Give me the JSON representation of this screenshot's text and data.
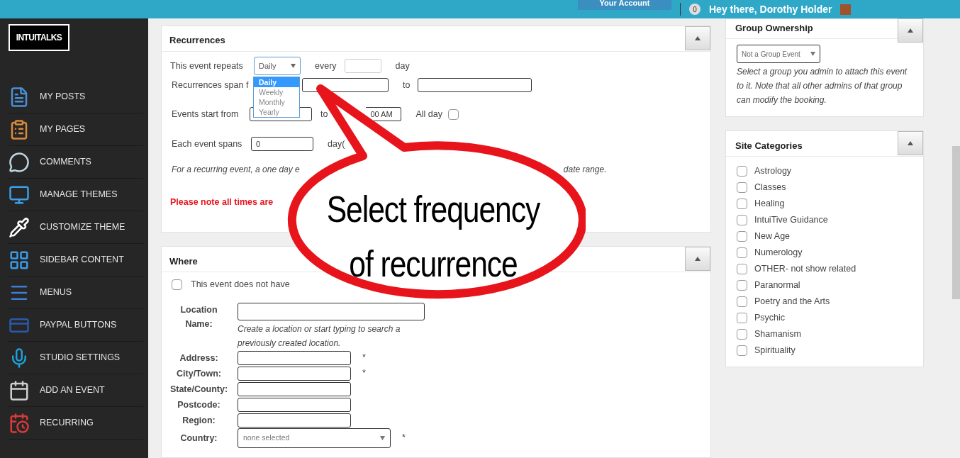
{
  "topbar": {
    "account_button": "Your Account",
    "notification_count": "0",
    "greeting": "Hey there, Dorothy Holder"
  },
  "logo": "INTUITALKS",
  "sidebar": {
    "items": [
      {
        "label": "MY POSTS"
      },
      {
        "label": "MY PAGES"
      },
      {
        "label": "COMMENTS"
      },
      {
        "label": "MANAGE THEMES"
      },
      {
        "label": "CUSTOMIZE THEME"
      },
      {
        "label": "SIDEBAR CONTENT"
      },
      {
        "label": "MENUS"
      },
      {
        "label": "PAYPAL BUTTONS"
      },
      {
        "label": "STUDIO SETTINGS"
      },
      {
        "label": "ADD AN EVENT"
      },
      {
        "label": "RECURRING"
      }
    ]
  },
  "recurrences": {
    "title": "Recurrences",
    "repeats_label": "This event repeats",
    "repeats_value": "Daily",
    "every_label": "every",
    "day_label": "day",
    "span_label": "Recurrences span f",
    "to_label": "to",
    "start_label": "Events start from",
    "start_to_label": "to",
    "end_time_visible": "00 AM",
    "allday_label": "All day",
    "allday_checked": false,
    "spans_label": "Each event spans",
    "spans_value": "0",
    "spans_unit": "day(",
    "hint_start": "For a recurring event, a one day e",
    "hint_end": "date range.",
    "note": "Please note all times are",
    "dropdown": {
      "options": [
        {
          "label": "Daily",
          "selected": true
        },
        {
          "label": "Weekly",
          "selected": false
        },
        {
          "label": "Monthly",
          "selected": false
        },
        {
          "label": "Yearly",
          "selected": false
        }
      ]
    }
  },
  "where": {
    "title": "Where",
    "no_location_label": "This event does not have",
    "no_location_checked": false,
    "location_label": "Location Name:",
    "location_hint": "Create a location or start typing to search a previously created location.",
    "fields": [
      {
        "label": "Address:",
        "required_mark": "*"
      },
      {
        "label": "City/Town:",
        "required_mark": "*"
      },
      {
        "label": "State/County:"
      },
      {
        "label": "Postcode:"
      },
      {
        "label": "Region:"
      }
    ],
    "country_label": "Country:",
    "country_value": "none selected",
    "country_required_mark": "*"
  },
  "group_ownership": {
    "title": "Group Ownership",
    "select_value": "Not a Group Event",
    "hint": "Select a group you admin to attach this event to it. Note that all other admins of that group can modify the booking."
  },
  "site_categories": {
    "title": "Site Categories",
    "items": [
      {
        "label": "Astrology",
        "checked": false
      },
      {
        "label": "Classes",
        "checked": false
      },
      {
        "label": "Healing",
        "checked": false
      },
      {
        "label": "IntuiTive Guidance",
        "checked": false
      },
      {
        "label": "New Age",
        "checked": false
      },
      {
        "label": "Numerology",
        "checked": false
      },
      {
        "label": "OTHER- not show related",
        "checked": false
      },
      {
        "label": "Paranormal",
        "checked": false
      },
      {
        "label": "Poetry and the Arts",
        "checked": false
      },
      {
        "label": "Psychic",
        "checked": false
      },
      {
        "label": "Shamanism",
        "checked": false
      },
      {
        "label": "Spirituality",
        "checked": false
      }
    ]
  },
  "callout": "Select frequency of recurrence"
}
